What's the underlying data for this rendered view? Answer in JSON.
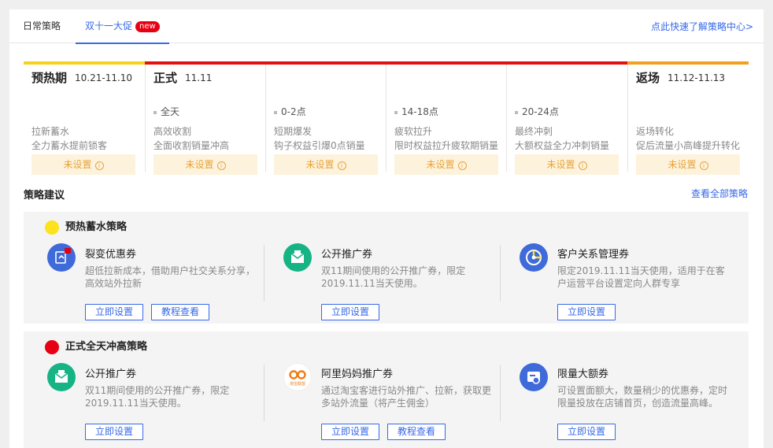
{
  "tabs": [
    {
      "label": "日常策略"
    },
    {
      "label": "双十一大促",
      "badge": "new"
    }
  ],
  "header_link": "点此快速了解策略中心>",
  "phases": {
    "pre": {
      "name": "预热期",
      "date": "10.21-11.10"
    },
    "main": {
      "name": "正式",
      "date": "11.11"
    },
    "ret": {
      "name": "返场",
      "date": "11.12-11.13"
    }
  },
  "segments": [
    {
      "sub": "",
      "name": "拉新蓄水",
      "desc": "全力蓄水提前锁客",
      "status": "未设置"
    },
    {
      "sub": "全天",
      "name": "高效收割",
      "desc": "全面收割销量冲高",
      "status": "未设置"
    },
    {
      "sub": "0-2点",
      "name": "短期爆发",
      "desc": "钩子权益引爆0点销量",
      "status": "未设置"
    },
    {
      "sub": "14-18点",
      "name": "疲软拉升",
      "desc": "限时权益拉升疲软期销量",
      "status": "未设置"
    },
    {
      "sub": "20-24点",
      "name": "最终冲刺",
      "desc": "大额权益全力冲刺销量",
      "status": "未设置"
    },
    {
      "sub": "",
      "name": "返场转化",
      "desc": "促后流量小高峰提升转化",
      "status": "未设置"
    }
  ],
  "suggestions": {
    "title": "策略建议",
    "link": "查看全部策略"
  },
  "groups": [
    {
      "title": "预热蓄水策略",
      "color": "#fde21c",
      "cards": [
        {
          "icon": "fission-coupon-icon",
          "title": "裂变优惠券",
          "desc": "超低拉新成本，借助用户社交关系分享，高效站外拉新",
          "buttons": [
            "立即设置",
            "教程查看"
          ]
        },
        {
          "icon": "envelope-icon",
          "title": "公开推广券",
          "desc": "双11期间使用的公开推广券，限定2019.11.11当天使用。",
          "buttons": [
            "立即设置"
          ]
        },
        {
          "icon": "crm-icon",
          "title": "客户关系管理券",
          "desc": "限定2019.11.11当天使用，适用于在客户运营平台设置定向人群专享",
          "buttons": [
            "立即设置"
          ]
        }
      ]
    },
    {
      "title": "正式全天冲高策略",
      "color": "#e60012",
      "cards": [
        {
          "icon": "envelope-icon",
          "title": "公开推广券",
          "desc": "双11期间使用的公开推广券，限定2019.11.11当天使用。",
          "buttons": [
            "立即设置"
          ]
        },
        {
          "icon": "alimama-logo-icon",
          "title": "阿里妈妈推广券",
          "desc": "通过淘宝客进行站外推广、拉新，获取更多站外流量（将产生佣金）",
          "buttons": [
            "立即设置",
            "教程查看"
          ],
          "logo_text": "淘宝联盟"
        },
        {
          "icon": "large-coupon-icon",
          "title": "限量大额券",
          "desc": "可设置面额大，数量稍少的优惠券，定时限量投放在店铺首页，创造流量高峰。",
          "buttons": [
            "立即设置"
          ]
        }
      ]
    }
  ],
  "colors": {
    "accent": "#3768e8",
    "pre_bar": "#f7d21a",
    "main_bar": "#e3110f",
    "return_bar": "#f3a01e",
    "status_bg": "#fdf3dd",
    "status_text": "#e8a33c"
  }
}
